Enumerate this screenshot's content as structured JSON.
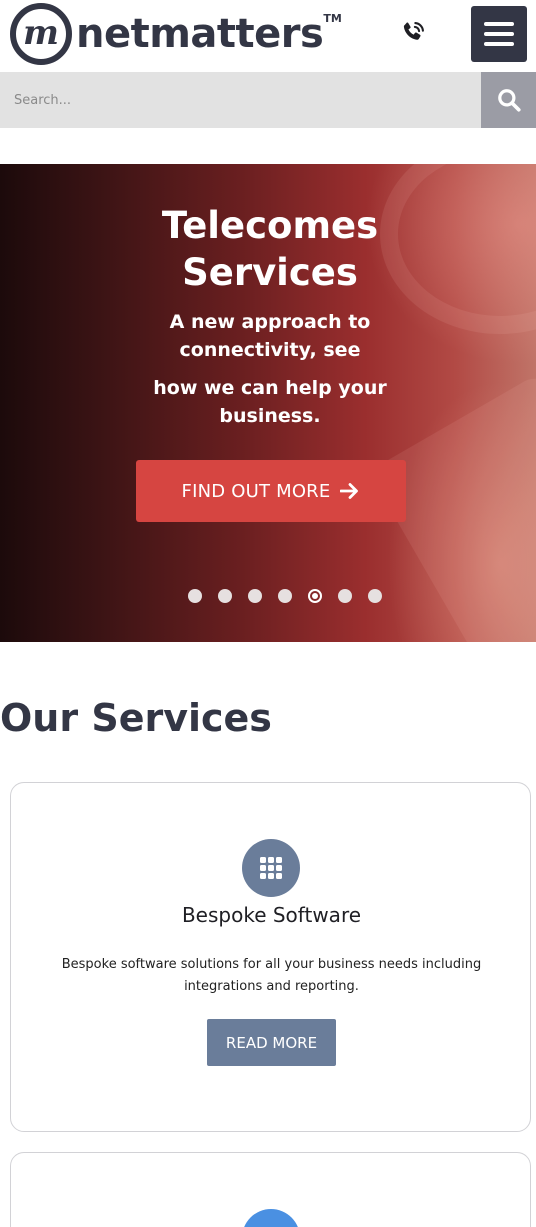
{
  "header": {
    "logo_mark": "m",
    "logo_text": "netmatters",
    "logo_tm": "TM",
    "phone_icon": "phone-icon",
    "menu_icon": "hamburger-icon"
  },
  "search": {
    "placeholder": "Search...",
    "value": "",
    "button_icon": "search-icon"
  },
  "hero": {
    "title_line1": "Telecomes",
    "title_line2": "Services",
    "subtitle_line1": "A new approach to",
    "subtitle_line2": "connectivity, see",
    "subtitle_line3": "how we can help your",
    "subtitle_line4": "business.",
    "cta_label": "FIND OUT MORE",
    "cta_icon": "arrow-right-icon",
    "slide_count": 7,
    "active_slide": 5
  },
  "services": {
    "title": "Our Services",
    "cards": [
      {
        "icon": "grid-apps-icon",
        "title": "Bespoke Software",
        "description_line1": "Bespoke software solutions for all your business needs including",
        "description_line2": "integrations and reporting.",
        "button_label": "READ MORE"
      }
    ]
  },
  "colors": {
    "brand_dark": "#333645",
    "cta_red": "#d64541",
    "service_blue_grey": "#6a7d9a",
    "service_blue": "#4a90e2",
    "search_bg": "#e2e2e2",
    "search_button": "#9b9ca5"
  }
}
